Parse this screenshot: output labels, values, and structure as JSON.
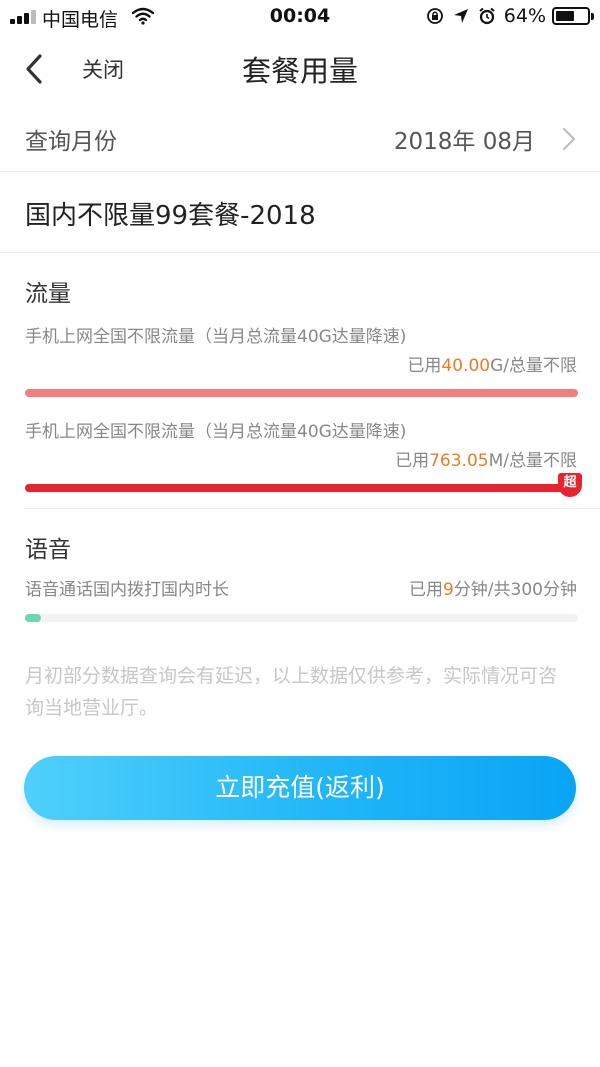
{
  "status_bar": {
    "carrier": "中国电信",
    "time": "00:04",
    "battery_percent": "64%",
    "battery_level": 0.64,
    "icons": [
      "signal-icon",
      "wifi-icon",
      "orientation-lock-icon",
      "location-arrow-icon",
      "alarm-icon",
      "battery-icon"
    ]
  },
  "nav": {
    "back_icon": "chevron-left-icon",
    "close_label": "关闭",
    "title": "套餐用量"
  },
  "month": {
    "label": "查询月份",
    "value": "2018年 08月",
    "chevron_icon": "chevron-right-icon"
  },
  "plan": {
    "name": "国内不限量99套餐-2018"
  },
  "data_section": {
    "title": "流量",
    "items": [
      {
        "desc": "手机上网全国不限流量（当月总流量40G达量降速)",
        "used_prefix": "已用",
        "used_value": "40.00",
        "used_suffix": "G/总量不限",
        "bar_color": "#f47e7e",
        "progress": 1.0
      },
      {
        "desc": "手机上网全国不限流量（当月总流量40G达量降速)",
        "used_prefix": "已用",
        "used_value": "763.05",
        "used_suffix": "M/总量不限",
        "bar_color": "#e8232e",
        "progress": 1.0,
        "badge": "超"
      }
    ]
  },
  "voice_section": {
    "title": "语音",
    "items": [
      {
        "desc": "语音通话国内拨打国内时长",
        "used_prefix": "已用",
        "used_value": "9",
        "used_suffix": "分钟/共300分钟",
        "bar_color": "#6ad8b0",
        "progress": 0.03
      }
    ]
  },
  "note": "月初部分数据查询会有延迟，以上数据仅供参考，实际情况可咨询当地营业厅。",
  "cta": {
    "label": "立即充值(返利)"
  },
  "colors": {
    "highlight": "#f07a23",
    "cta_start": "#4fd0fb",
    "cta_end": "#0aa4f6"
  }
}
